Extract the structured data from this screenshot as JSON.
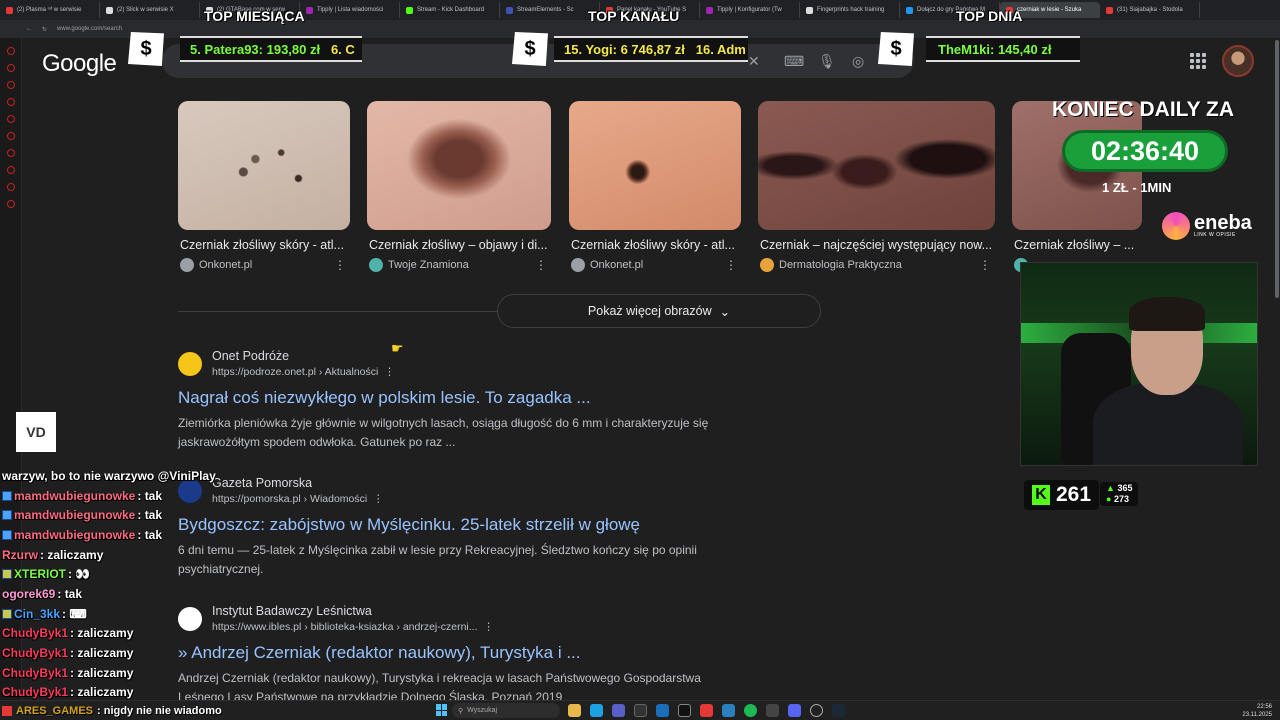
{
  "browser": {
    "tabs": [
      {
        "label": "(2) Plasma ⁿᵈ w serwisie",
        "color": "#e53935"
      },
      {
        "label": "(2) Slick w serwisie X",
        "color": "#dddddd"
      },
      {
        "label": "(2) GTABase.com w serw",
        "color": "#dddddd"
      },
      {
        "label": "Tipply | Lista wiadomości",
        "color": "#9c27b0"
      },
      {
        "label": "Stream - Kick Dashboard",
        "color": "#53fc18"
      },
      {
        "label": "StreamElements - Sc",
        "color": "#3f51b5"
      },
      {
        "label": "Panel kanału - YouTube S",
        "color": "#e53935"
      },
      {
        "label": "Tipply | Konfigurator (Tw",
        "color": "#9c27b0"
      },
      {
        "label": "Fingerprints hack training",
        "color": "#dddddd"
      },
      {
        "label": "Dołącz do gry Państwa M",
        "color": "#2196f3"
      },
      {
        "label": "czerniak w lesie - Szuka",
        "color": "#e53935",
        "active": true
      },
      {
        "label": "(31) Siajabajka - Stodola",
        "color": "#e53935"
      }
    ],
    "url": "www.google.com/search"
  },
  "google": {
    "logo": "Google",
    "search_icons": {
      "clear": "✕",
      "keyboard": "⌨",
      "mic": "🎙",
      "lens": "◎"
    }
  },
  "images": [
    {
      "caption": "Czerniak złośliwy skóry - atl...",
      "source": "Onkonet.pl",
      "source_color": "#9aa0a6"
    },
    {
      "caption": "Czerniak złośliwy – objawy i di...",
      "source": "Twoje Znamiona",
      "source_color": "#4fb3a9"
    },
    {
      "caption": "Czerniak złośliwy skóry - atl...",
      "source": "Onkonet.pl",
      "source_color": "#9aa0a6"
    },
    {
      "caption": "Czerniak – najczęściej występujący now...",
      "source": "Dermatologia Praktyczna",
      "source_color": "#e8a33d"
    },
    {
      "caption": "Czerniak złośliwy – ...",
      "source": "",
      "source_color": "#4fb3a9"
    }
  ],
  "show_more_label": "Pokaż więcej obrazów",
  "results": [
    {
      "site": "Onet Podróże",
      "url": "https://podroze.onet.pl › Aktualności",
      "title": "Nagrał coś niezwykłego w polskim lesie. To zagadka ...",
      "snippet": "Ziemiórka pleniówka żyje głównie w wilgotnych lasach, osiąga długość do 6 mm i charakteryzuje się jaskrawożółtym spodem odwłoka. Gatunek po raz ...",
      "icon_color": "#f5c518"
    },
    {
      "site": "Gazeta Pomorska",
      "url": "https://pomorska.pl › Wiadomości",
      "title": "Bydgoszcz: zabójstwo w Myślęcinku. 25-latek strzelił w głowę",
      "snippet": "6 dni temu — 25-latek z Myślęcinka zabił w lesie przy Rekreacyjnej. Śledztwo kończy się po opinii psychiatrycznej.",
      "icon_color": "#1a3a8a"
    },
    {
      "site": "Instytut Badawczy Leśnictwa",
      "url": "https://www.ibles.pl › biblioteka-ksiazka › andrzej-czerni...",
      "title": "» Andrzej Czerniak (redaktor naukowy), Turystyka i ...",
      "snippet": "Andrzej Czerniak (redaktor naukowy), Turystyka i rekreacja w lasach Państwowego Gospodarstwa Leśnego Lasy Państwowe na przykładzie Dolnego Śląska. Poznań 2019",
      "icon_color": "#ffffff"
    }
  ],
  "overlays": {
    "top_month": {
      "title": "TOP MIESIĄCA",
      "entry": "5. Patera93: 193,80 zł",
      "next": "6. C"
    },
    "top_channel": {
      "title": "TOP KANAŁU",
      "entry": "15. Yogi: 6 746,87 zł",
      "next": "16. Adm"
    },
    "top_day": {
      "title": "TOP DNIA",
      "entry": "TheM1ki: 145,40 zł"
    },
    "dollar": "$",
    "daily_title": "KONIEC DAILY ZA",
    "daily_timer": "02:36:40",
    "daily_rate": "1 ZŁ - 1MIN",
    "eneba_name": "eneba",
    "eneba_sub": "LINK W OPISIE",
    "kick_logo": "K",
    "kick_viewers": "261",
    "kick_stat_1": "365",
    "kick_stat_2": "273"
  },
  "chat": {
    "avatar_text": "VD",
    "lines": [
      {
        "user": "",
        "message": "warzyw, bo to nie warzywo @ViniPlay",
        "user_color": "#ffffff",
        "badge": ""
      },
      {
        "user": "mamdwubiegunowke",
        "message": ": tak",
        "user_color": "#ff6b81",
        "badge": "b"
      },
      {
        "user": "mamdwubiegunowke",
        "message": ": tak",
        "user_color": "#ff6b81",
        "badge": "b"
      },
      {
        "user": "mamdwubiegunowke",
        "message": ": tak",
        "user_color": "#ff6b81",
        "badge": "b"
      },
      {
        "user": "Rzurw",
        "message": ": zaliczamy",
        "user_color": "#ff6b81",
        "badge": ""
      },
      {
        "user": "XTERIOT",
        "message": ": 👀",
        "user_color": "#7CFC40",
        "badge": "y"
      },
      {
        "user": "ogorek69",
        "message": ": tak",
        "user_color": "#ff9ad5",
        "badge": ""
      },
      {
        "user": "Cin_3kk",
        "message": ": ⌨",
        "user_color": "#4aa3ff",
        "badge": "y"
      },
      {
        "user": "ChudyByk1",
        "message": ": zaliczamy",
        "user_color": "#ff3b5c",
        "badge": ""
      },
      {
        "user": "ChudyByk1",
        "message": ": zaliczamy",
        "user_color": "#ff3b5c",
        "badge": ""
      },
      {
        "user": "ChudyByk1",
        "message": ": zaliczamy",
        "user_color": "#ff3b5c",
        "badge": ""
      },
      {
        "user": "ChudyByk1",
        "message": ": zaliczamy",
        "user_color": "#ff3b5c",
        "badge": ""
      }
    ]
  },
  "ticker": {
    "user": "ARES_GAMES",
    "message": ": nigdy nie nie wiadomo"
  },
  "taskbar": {
    "search_placeholder": "Wyszukaj",
    "time": "22:56",
    "date": "23.11.2025"
  },
  "colors": {
    "link": "#99c3ff",
    "bg": "#1f1f1f",
    "kick_green": "#53fc18",
    "timer_green": "#19a03a"
  }
}
